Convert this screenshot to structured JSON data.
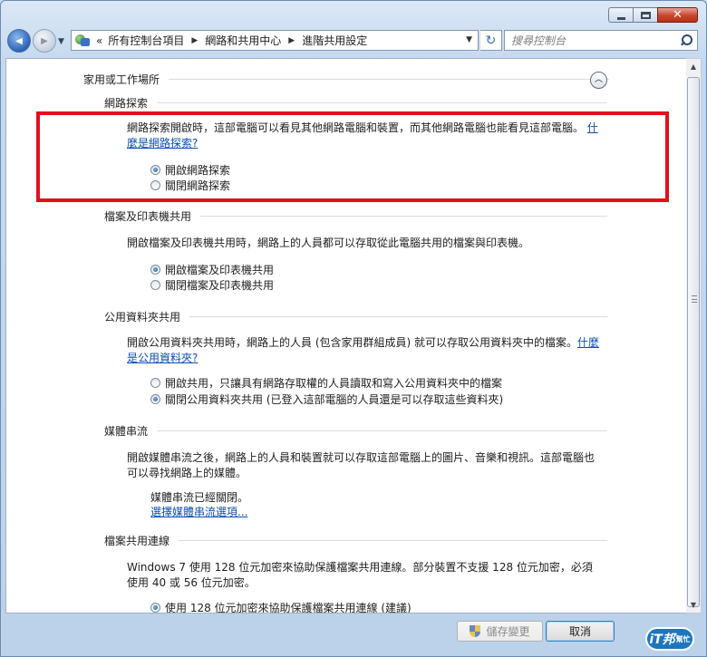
{
  "window": {
    "caption_min": "",
    "caption_max": "",
    "caption_close": "✕"
  },
  "nav": {
    "back_glyph": "◀",
    "forward_glyph": "▶",
    "history_drop": "▼",
    "breadcrumb": [
      "所有控制台項目",
      "網路和共用中心",
      "進階共用設定"
    ],
    "overflow": "«",
    "sep": "▶",
    "address_drop": "▼",
    "refresh_glyph": "↻",
    "search_placeholder": "搜尋控制台"
  },
  "profile": {
    "title": "家用或工作場所",
    "collapse_glyph": "︿"
  },
  "sections": {
    "discovery": {
      "title": "網路探索",
      "desc": "網路探索開啟時，這部電腦可以看見其他網路電腦和裝置，而其他網路電腦也能看見這部電腦。",
      "link": "什麼是網路探索?",
      "options": [
        "開啟網路探索",
        "關閉網路探索"
      ],
      "selected": 0
    },
    "printer": {
      "title": "檔案及印表機共用",
      "desc": "開啟檔案及印表機共用時，網路上的人員都可以存取從此電腦共用的檔案與印表機。",
      "options": [
        "開啟檔案及印表機共用",
        "關閉檔案及印表機共用"
      ],
      "selected": 0
    },
    "public": {
      "title": "公用資料夾共用",
      "desc": "開啟公用資料夾共用時，網路上的人員 (包含家用群組成員) 就可以存取公用資料夾中的檔案。",
      "link": "什麼是公用資料夾?",
      "options": [
        "開啟共用，只讓具有網路存取權的人員讀取和寫入公用資料夾中的檔案",
        "關閉公用資料夾共用 (已登入這部電腦的人員還是可以存取這些資料夾)"
      ],
      "selected": 1
    },
    "media": {
      "title": "媒體串流",
      "desc": "開啟媒體串流之後，網路上的人員和裝置就可以存取這部電腦上的圖片、音樂和視訊。這部電腦也可以尋找網路上的媒體。",
      "status": "媒體串流已經關閉。",
      "link": "選擇媒體串流選項..."
    },
    "encryption": {
      "title": "檔案共用連線",
      "desc": "Windows 7 使用 128 位元加密來協助保護檔案共用連線。部分裝置不支援 128 位元加密，必須使用 40 或 56 位元加密。",
      "options": [
        "使用 128 位元加密來協助保護檔案共用連線 (建議)"
      ],
      "selected": 0
    }
  },
  "footer": {
    "save": "儲存變更",
    "cancel": "取消"
  },
  "watermark": {
    "main": "iT邦",
    "sub": "幫忙"
  },
  "colors": {
    "highlight_box": "#e2101b",
    "link": "#0b4fb2"
  }
}
